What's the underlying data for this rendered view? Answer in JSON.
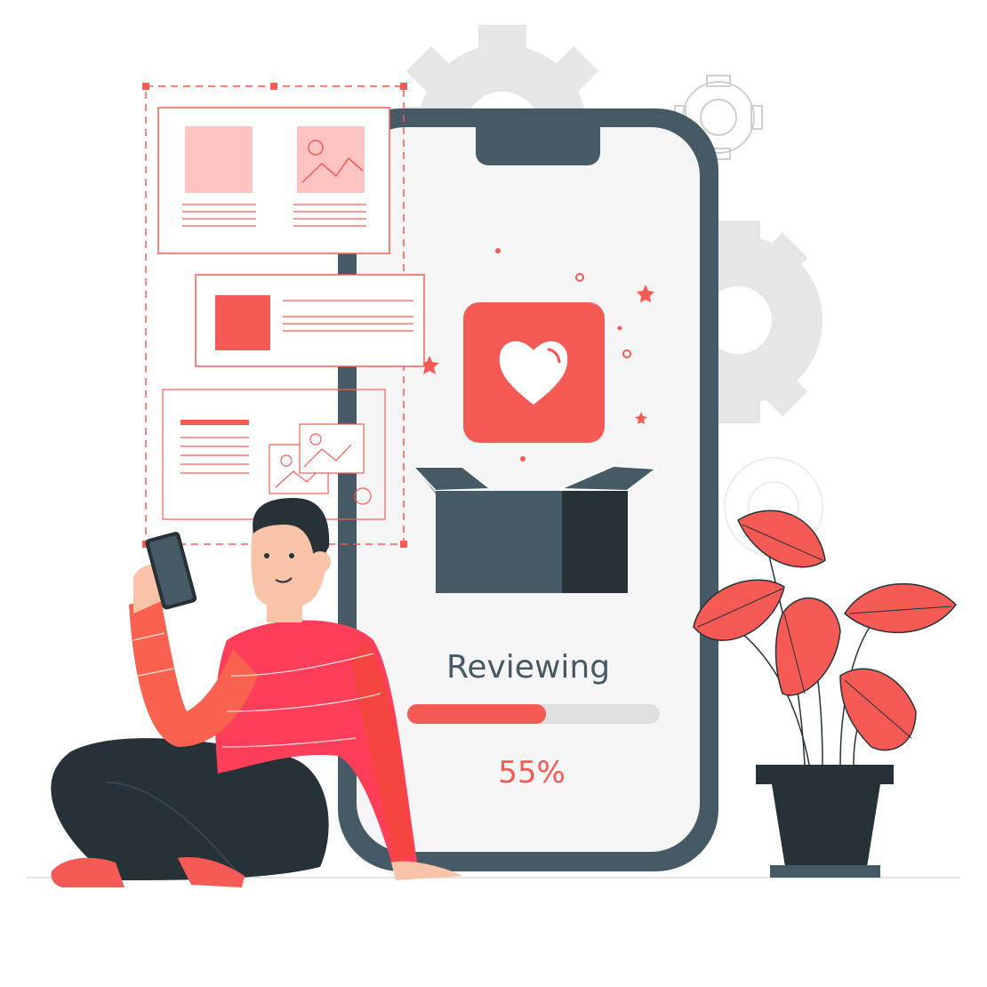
{
  "phone": {
    "status_label": "Reviewing",
    "progress_text": "55%",
    "progress_fraction": 0.55
  },
  "colors": {
    "accent": "#F65A55",
    "accent_light": "#FFC3C1",
    "dark": "#455A64",
    "darker": "#263238",
    "gear": "#E6E6E6",
    "screen": "#F5F5F5",
    "track": "#E0E0E0"
  },
  "icons": [
    "heart-icon",
    "gear-icon",
    "star-icon",
    "image-icon",
    "box-icon"
  ]
}
